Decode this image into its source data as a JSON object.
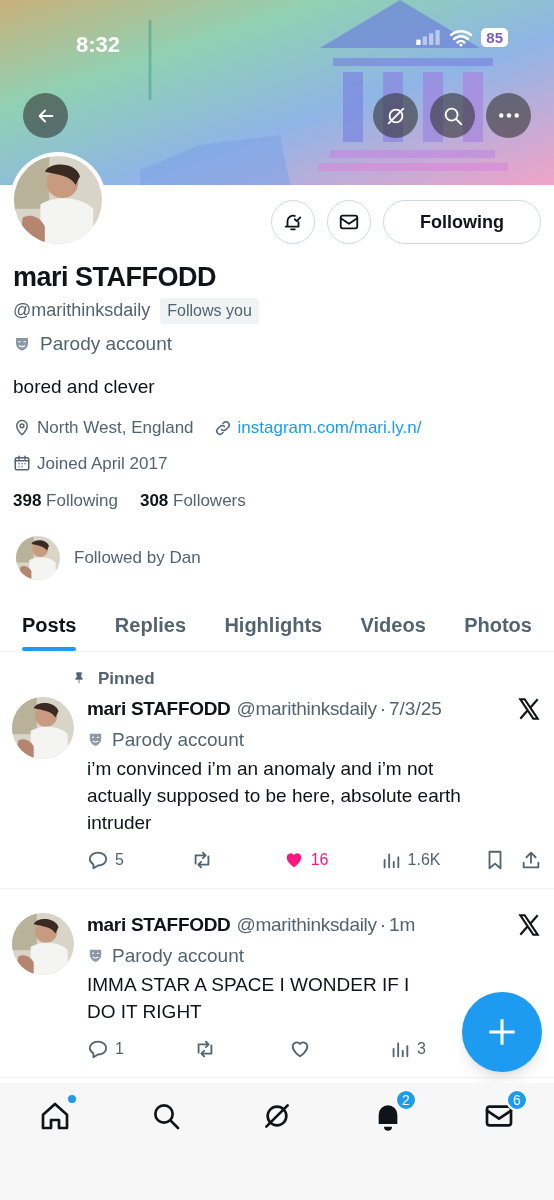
{
  "status_bar": {
    "time": "8:32",
    "battery": "85"
  },
  "header_actions": [
    {
      "kind": "back"
    },
    {
      "kind": "grok"
    },
    {
      "kind": "search"
    },
    {
      "kind": "more"
    }
  ],
  "profile": {
    "actions": [
      {
        "kind": "notify"
      },
      {
        "kind": "message"
      },
      {
        "kind": "follow",
        "label": "Following"
      }
    ],
    "name": "mari STAFFODD",
    "handle": "@marithinksdaily",
    "follows_you": "Follows you",
    "label": "Parody account",
    "bio": "bored and clever",
    "meta": [
      {
        "kind": "location",
        "text": "North West, England"
      },
      {
        "kind": "link",
        "text": "instagram.com/mari.ly.n/"
      },
      {
        "kind": "joined",
        "text": "Joined April 2017"
      }
    ],
    "counts": [
      {
        "text": "**398** Following"
      },
      {
        "text": "**308** Followers"
      }
    ],
    "followed_by": "Followed by Dan"
  },
  "tabs": [
    {
      "label": "Posts",
      "selected": true
    },
    {
      "label": "Replies",
      "selected": false
    },
    {
      "label": "Highlights",
      "selected": false
    },
    {
      "label": "Videos",
      "selected": false
    },
    {
      "label": "Photos",
      "selected": false
    }
  ],
  "posts": [
    {
      "pinned_label": "Pinned",
      "name": "mari STAFFODD",
      "handle": "@marithinksdaily",
      "separator": "·",
      "time": "7/3/25",
      "label": "Parody account",
      "text": "i’m convinced i’m an anomaly and i’m not actually supposed to be here, absolute earth intruder",
      "liked": true,
      "stats": [
        {
          "kind": "reply",
          "count": "5"
        },
        {
          "kind": "repost"
        },
        {
          "kind": "like",
          "count": "16"
        },
        {
          "kind": "views",
          "count": "1.6K"
        },
        {
          "kind": "bookmark"
        },
        {
          "kind": "share"
        }
      ]
    },
    {
      "name": "mari STAFFODD",
      "handle": "@marithinksdaily",
      "separator": "·",
      "time": "1m",
      "label": "Parody account",
      "text": "IMMA STAR A SPACE I WONDER IF I DO IT RIGHT",
      "liked": false,
      "stats": [
        {
          "kind": "reply",
          "count": "1"
        },
        {
          "kind": "repost"
        },
        {
          "kind": "like"
        },
        {
          "kind": "views",
          "count": "3"
        }
      ]
    }
  ],
  "nav": [
    {
      "kind": "home",
      "dot": true
    },
    {
      "kind": "search"
    },
    {
      "kind": "grok"
    },
    {
      "kind": "notifications",
      "badge": "2"
    },
    {
      "kind": "messages",
      "badge": "6"
    }
  ]
}
